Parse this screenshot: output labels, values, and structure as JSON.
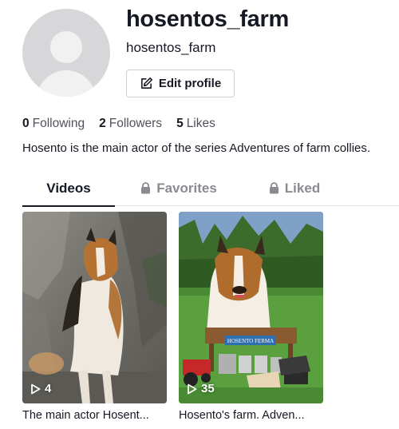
{
  "profile": {
    "username": "hosentos_farm",
    "nickname": "hosentos_farm",
    "edit_label": "Edit profile",
    "bio": "Hosento is the main actor of the series Adventures of farm collies."
  },
  "stats": {
    "following_count": "0",
    "following_label": "Following",
    "followers_count": "2",
    "followers_label": "Followers",
    "likes_count": "5",
    "likes_label": "Likes"
  },
  "tabs": [
    {
      "label": "Videos",
      "active": true,
      "icon": ""
    },
    {
      "label": "Favorites",
      "active": false,
      "icon": "lock-icon"
    },
    {
      "label": "Liked",
      "active": false,
      "icon": "lock-icon"
    }
  ],
  "videos": [
    {
      "views": "4",
      "caption": "The main actor Hosent...",
      "icon": "play-icon"
    },
    {
      "views": "35",
      "caption": "Hosento's farm. Adven...",
      "icon": "play-icon",
      "sign_text": "HOSENTO FERMA"
    }
  ],
  "colors": {
    "text_primary": "#161823",
    "text_secondary": "#8a8b91",
    "border": "#d0d0d3",
    "avatar_bg": "#d7d7da"
  }
}
